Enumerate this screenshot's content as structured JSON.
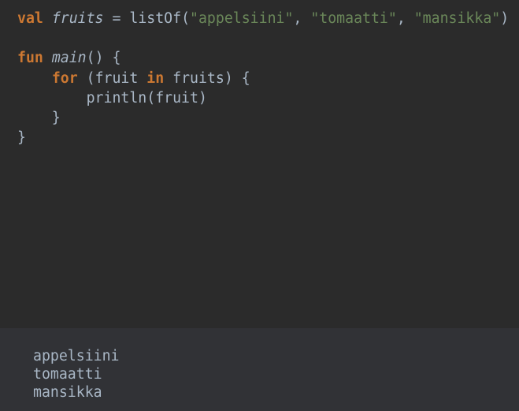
{
  "code": {
    "lines": [
      [
        {
          "t": "val",
          "c": "kw"
        },
        {
          "t": " "
        },
        {
          "t": "fruits",
          "c": "it"
        },
        {
          "t": " = listOf("
        },
        {
          "t": "\"appelsiini\"",
          "c": "str"
        },
        {
          "t": ", "
        },
        {
          "t": "\"tomaatti\"",
          "c": "str"
        },
        {
          "t": ", "
        },
        {
          "t": "\"mansikka\"",
          "c": "str"
        },
        {
          "t": ")"
        }
      ],
      [],
      [
        {
          "t": "fun",
          "c": "kw"
        },
        {
          "t": " "
        },
        {
          "t": "main",
          "c": "it"
        },
        {
          "t": "() {"
        }
      ],
      [
        {
          "t": "    "
        },
        {
          "t": "for",
          "c": "kw"
        },
        {
          "t": " (fruit "
        },
        {
          "t": "in",
          "c": "kw"
        },
        {
          "t": " fruits) {"
        }
      ],
      [
        {
          "t": "        println(fruit)"
        }
      ],
      [
        {
          "t": "    }"
        }
      ],
      [
        {
          "t": "}"
        }
      ]
    ]
  },
  "output": {
    "lines": [
      "appelsiini",
      "tomaatti",
      "mansikka"
    ]
  },
  "colors": {
    "keyword": "#cc7832",
    "string": "#6a8759",
    "text": "#a9b7c6",
    "editor_bg": "#2b2b2b",
    "output_bg": "#313236"
  }
}
